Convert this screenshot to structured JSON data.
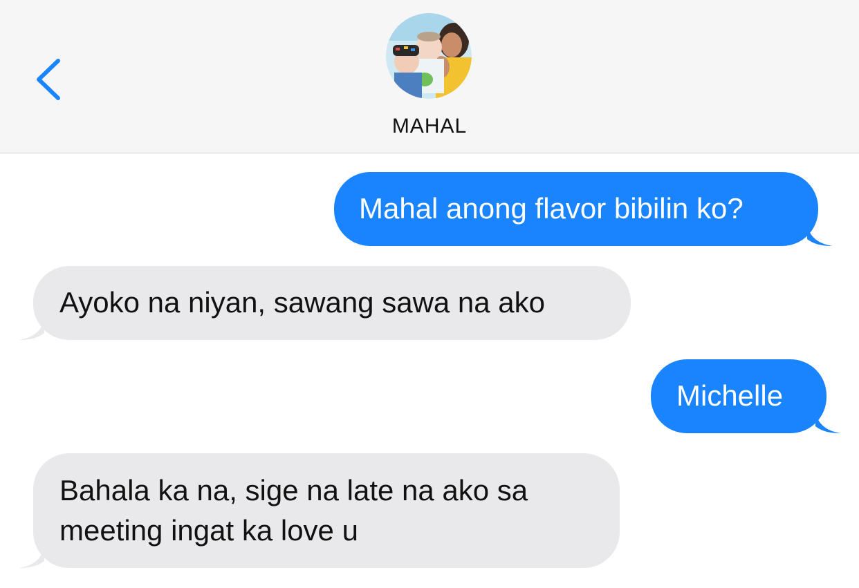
{
  "header": {
    "contact_name": "MAHAL",
    "back_icon": "chevron-left-icon",
    "accent_color": "#1a84ff"
  },
  "messages": [
    {
      "direction": "outgoing",
      "text": "Mahal anong flavor bibilin ko?"
    },
    {
      "direction": "incoming",
      "text": "Ayoko na niyan, sawang sawa na ako"
    },
    {
      "direction": "outgoing",
      "text": "Michelle"
    },
    {
      "direction": "incoming",
      "text": "Bahala ka na, sige na late na ako sa\nmeeting ingat ka love u"
    }
  ],
  "colors": {
    "outgoing_bubble": "#1a84ff",
    "incoming_bubble": "#e9e9eb",
    "header_bg": "#f6f6f6"
  }
}
